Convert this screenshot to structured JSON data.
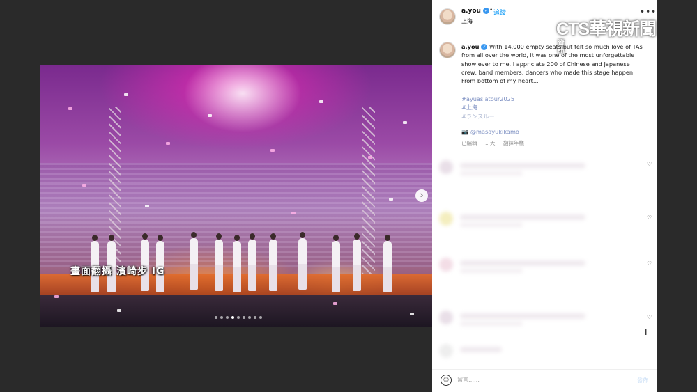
{
  "header": {
    "username": "a.you",
    "follow_label": "追蹤",
    "separator": "•",
    "location": "上海",
    "more_icon": "more-icon"
  },
  "watermark": {
    "logo_text": "CTS華視新聞",
    "logo_small": "資訊"
  },
  "photo": {
    "caption": "畫面翻攝 濱崎步 IG",
    "next_icon": "chevron-right-icon",
    "carousel_dots": 9,
    "active_dot": 4
  },
  "post": {
    "username": "a.you",
    "text": "With 14,000 empty seats but felt so much love of TAs from all over the world, it was one of the most unforgettable show ever to me. I appriciate 200 of Chinese and Japanese crew, band members, dancers who made this stage happen. From bottom of my heart...",
    "hashtags": [
      "#ayuasiatour2025",
      "#上海",
      "#ランスルー"
    ],
    "credit_icon": "camera-emoji",
    "credit": "@masayukikamo",
    "meta": {
      "edited": "已編輯",
      "age": "1 天",
      "translate": "翻譯年糕"
    }
  },
  "comments_blurred": 5,
  "footer": {
    "emoji_icon": "smile-icon",
    "input_placeholder": "留言……",
    "post_label": "發佈"
  }
}
